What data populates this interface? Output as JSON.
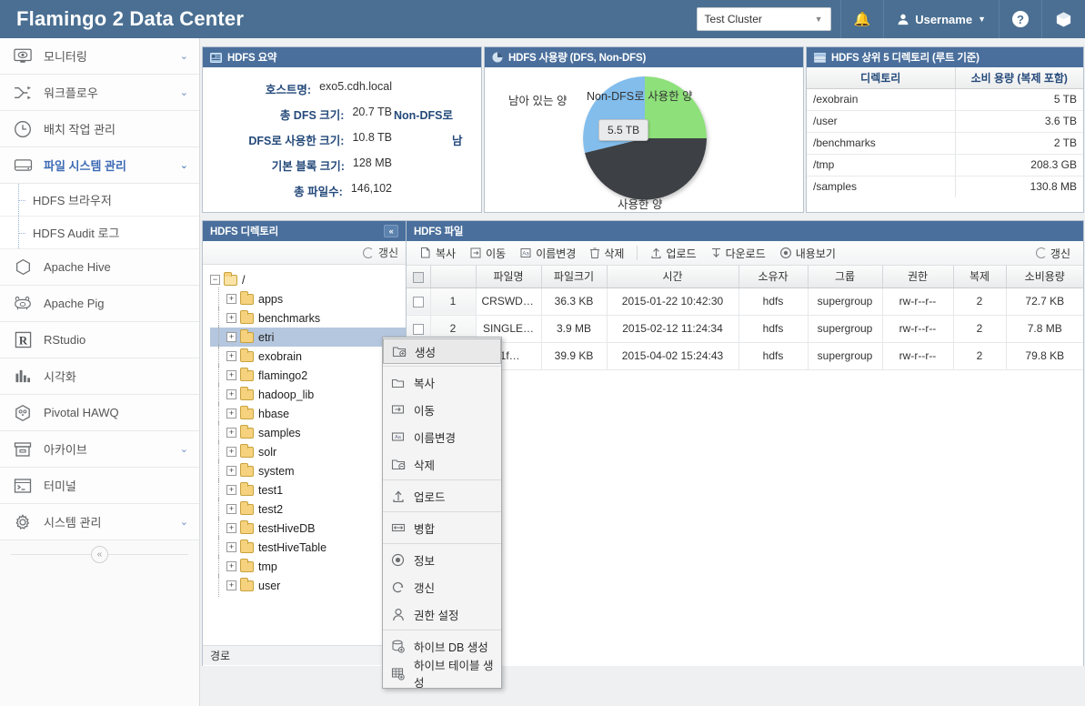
{
  "header": {
    "brand": "Flamingo 2 Data Center",
    "cluster_value": "Test Cluster",
    "bell_icon": "bell-icon",
    "username": "Username",
    "help_icon": "help-icon",
    "cube_icon": "cube-icon"
  },
  "sidebar": {
    "items": [
      {
        "label": "모니터링",
        "icon": "monitor-eye-icon",
        "chevron": "⌄",
        "active": false
      },
      {
        "label": "워크플로우",
        "icon": "workflow-icon",
        "chevron": "⌄",
        "active": false
      },
      {
        "label": "배치 작업 관리",
        "icon": "clock-icon",
        "chevron": "",
        "active": false
      },
      {
        "label": "파일 시스템 관리",
        "icon": "drive-icon",
        "chevron": "⌄",
        "active": true
      }
    ],
    "sub_items": [
      {
        "label": "HDFS 브라우저"
      },
      {
        "label": "HDFS Audit 로그"
      }
    ],
    "items2": [
      {
        "label": "Apache Hive",
        "icon": "hexagon-icon",
        "chevron": ""
      },
      {
        "label": "Apache Pig",
        "icon": "pig-icon",
        "chevron": ""
      },
      {
        "label": "RStudio",
        "icon": "r-box-icon",
        "chevron": ""
      },
      {
        "label": "시각화",
        "icon": "bar-chart-icon",
        "chevron": ""
      },
      {
        "label": "Pivotal HAWQ",
        "icon": "hawq-owl-icon",
        "chevron": ""
      },
      {
        "label": "아카이브",
        "icon": "archive-box-icon",
        "chevron": "⌄"
      },
      {
        "label": "터미널",
        "icon": "terminal-icon",
        "chevron": ""
      },
      {
        "label": "시스템 관리",
        "icon": "gear-icon",
        "chevron": "⌄"
      }
    ],
    "collapse_glyph": "«"
  },
  "summary_panel": {
    "title": "HDFS 요약",
    "icon": "summary-card-icon",
    "rows": [
      {
        "label": "호스트명:",
        "value": "exo5.cdh.local"
      },
      {
        "label": "총 DFS 크기:",
        "value": "20.7 TB"
      },
      {
        "label": "DFS로 사용한 크기:",
        "value": "10.8 TB"
      },
      {
        "label": "기본 블록 크기:",
        "value": "128 MB"
      },
      {
        "label": "총 파일수:",
        "value": "146,102"
      }
    ],
    "clipped_col": [
      {
        "label": "Non-DFS로",
        "value": ""
      },
      {
        "label": "남",
        "value": ""
      }
    ]
  },
  "pie_panel": {
    "title": "HDFS 사용량 (DFS, Non-DFS)",
    "icon": "pie-chart-icon",
    "tooltip": "5.5 TB"
  },
  "chart_data": {
    "type": "pie",
    "title": "HDFS 사용량 (DFS, Non-DFS)",
    "labels": [
      "Non-DFS로 사용한 양",
      "사용한 양",
      "남아 있는 양"
    ],
    "values": [
      25,
      45,
      30
    ],
    "colors": [
      "#8ee07a",
      "#3e4045",
      "#82bdec"
    ],
    "annotations": [
      "5.5 TB"
    ],
    "legend": "none",
    "grid": false
  },
  "top5_panel": {
    "title": "HDFS 상위 5 디렉토리 (루트 기준)",
    "icon": "list-table-icon",
    "columns": [
      "디렉토리",
      "소비 용량 (복제 포함)"
    ],
    "rows": [
      {
        "dir": "/exobrain",
        "size": "5 TB"
      },
      {
        "dir": "/user",
        "size": "3.6 TB"
      },
      {
        "dir": "/benchmarks",
        "size": "2 TB"
      },
      {
        "dir": "/tmp",
        "size": "208.3 GB"
      },
      {
        "dir": "/samples",
        "size": "130.8 MB"
      }
    ]
  },
  "tree_panel": {
    "title": "HDFS 디렉토리",
    "collapse_glyph": "«",
    "refresh_label": "갱신",
    "refresh_icon": "refresh-icon",
    "root": "/",
    "nodes": [
      {
        "label": "apps",
        "selected": false
      },
      {
        "label": "benchmarks",
        "selected": false
      },
      {
        "label": "etri",
        "selected": true
      },
      {
        "label": "exobrain",
        "selected": false
      },
      {
        "label": "flamingo2",
        "selected": false
      },
      {
        "label": "hadoop_lib",
        "selected": false
      },
      {
        "label": "hbase",
        "selected": false
      },
      {
        "label": "samples",
        "selected": false
      },
      {
        "label": "solr",
        "selected": false
      },
      {
        "label": "system",
        "selected": false
      },
      {
        "label": "test1",
        "selected": false
      },
      {
        "label": "test2",
        "selected": false
      },
      {
        "label": "testHiveDB",
        "selected": false
      },
      {
        "label": "testHiveTable",
        "selected": false
      },
      {
        "label": "tmp",
        "selected": false
      },
      {
        "label": "user",
        "selected": false
      }
    ],
    "status_label": "경로"
  },
  "file_panel": {
    "title": "HDFS 파일",
    "toolbar": [
      {
        "label": "복사",
        "icon": "copy-icon"
      },
      {
        "label": "이동",
        "icon": "move-icon"
      },
      {
        "label": "이름변경",
        "icon": "rename-icon"
      },
      {
        "label": "삭제",
        "icon": "trash-icon"
      },
      {
        "label": "업로드",
        "icon": "upload-icon"
      },
      {
        "label": "다운로드",
        "icon": "download-icon"
      },
      {
        "label": "내용보기",
        "icon": "view-content-icon"
      }
    ],
    "refresh_label": "갱신",
    "refresh_icon": "refresh-icon",
    "columns": [
      "파일명",
      "파일크기",
      "시간",
      "소유자",
      "그룹",
      "권한",
      "복제",
      "소비용량"
    ],
    "rows": [
      {
        "num": "1",
        "name": "CRSWD-…",
        "size": "36.3 KB",
        "time": "2015-01-22 10:42:30",
        "owner": "hdfs",
        "group": "supergroup",
        "perm": "rw-r--r--",
        "repl": "2",
        "used": "72.7 KB"
      },
      {
        "num": "2",
        "name": "SINGLE…",
        "size": "3.9 MB",
        "time": "2015-02-12 11:24:34",
        "owner": "hdfs",
        "group": "supergroup",
        "perm": "rw-r--r--",
        "repl": "2",
        "used": "7.8 MB"
      },
      {
        "num": "3",
        "name": ":1f…",
        "size": "39.9 KB",
        "time": "2015-04-02 15:24:43",
        "owner": "hdfs",
        "group": "supergroup",
        "perm": "rw-r--r--",
        "repl": "2",
        "used": "79.8 KB"
      }
    ]
  },
  "context_menu": {
    "items": [
      {
        "label": "생성",
        "icon": "folder-add-icon",
        "highlight": true,
        "sep_after": true
      },
      {
        "label": "복사",
        "icon": "copy-icon",
        "highlight": false,
        "sep_after": false
      },
      {
        "label": "이동",
        "icon": "move-icon",
        "highlight": false,
        "sep_after": false
      },
      {
        "label": "이름변경",
        "icon": "rename-icon",
        "highlight": false,
        "sep_after": false
      },
      {
        "label": "삭제",
        "icon": "folder-remove-icon",
        "highlight": false,
        "sep_after": true
      },
      {
        "label": "업로드",
        "icon": "upload-icon",
        "highlight": false,
        "sep_after": true
      },
      {
        "label": "병합",
        "icon": "merge-icon",
        "highlight": false,
        "sep_after": true
      },
      {
        "label": "정보",
        "icon": "info-eye-icon",
        "highlight": false,
        "sep_after": false
      },
      {
        "label": "갱신",
        "icon": "refresh-icon",
        "highlight": false,
        "sep_after": false
      },
      {
        "label": "권한 설정",
        "icon": "user-icon",
        "highlight": false,
        "sep_after": true
      },
      {
        "label": "하이브 DB 생성",
        "icon": "hive-db-add-icon",
        "highlight": false,
        "sep_after": false
      },
      {
        "label": "하이브 테이블 생성",
        "icon": "hive-table-add-icon",
        "highlight": false,
        "sep_after": false
      }
    ]
  },
  "colors": {
    "brand_blue": "#4a6f92",
    "panel_head": "#4a6f9c",
    "accent": "#3d6bb5",
    "pie_green": "#8ee07a",
    "pie_dark": "#3e4045",
    "pie_blue": "#82bdec"
  }
}
